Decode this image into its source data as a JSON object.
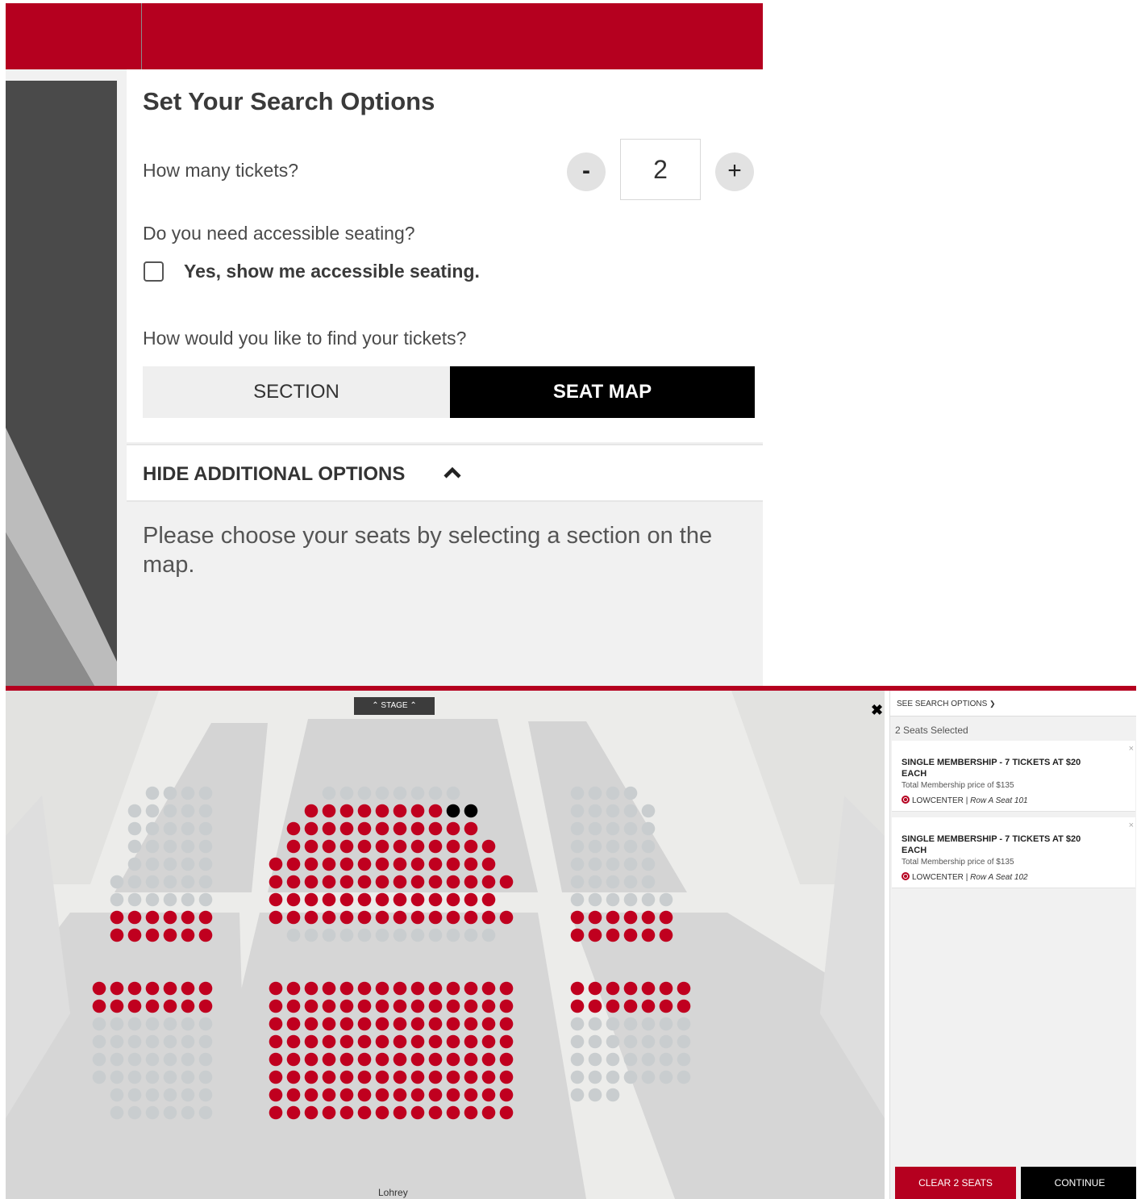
{
  "search_options": {
    "title": "Set Your Search Options",
    "tickets_question": "How many tickets?",
    "minus_label": "-",
    "plus_label": "+",
    "quantity": "2",
    "accessible_question": "Do you need accessible seating?",
    "accessible_checked": false,
    "accessible_label": "Yes, show me accessible seating.",
    "find_question": "How would you like to find your tickets?",
    "tabs": [
      {
        "label": "SECTION",
        "active": false
      },
      {
        "label": "SEAT MAP",
        "active": true
      }
    ],
    "hide_additional_label": "HIDE ADDITIONAL OPTIONS",
    "instructions": "Please choose your seats by selecting a section on the map."
  },
  "seat_map": {
    "stage_label": "STAGE",
    "venue_label": "Lohrey",
    "close_icon": "close-icon",
    "colors": {
      "available": "#c0001f",
      "unavailable": "#c9cdcf",
      "selected": "#000000",
      "brand": "#b5001f"
    },
    "sections": [
      {
        "name": "upper-left",
        "rows": [
          "..uuuu",
          ".uuuuu",
          ".uuuuu",
          ".uuuuu",
          ".uuuuu",
          "uuuuuu",
          "uuuuuu",
          "aaaaaa",
          "aaaaaa"
        ]
      },
      {
        "name": "upper-center",
        "rows": [
          "...uuuuuuuu",
          "..aaaaaaaass",
          ".aaaaaaaaaaa",
          ".aaaaaaaaaaaa",
          "aaaaaaaaaaaaa",
          "aaaaaaaaaaaaaa",
          "aaaaaaaaaaaaa",
          "aaaaaaaaaaaaaa",
          ".uuuuuuuuuuuu"
        ]
      },
      {
        "name": "upper-right",
        "rows": [
          "uuuu",
          "uuuuu",
          "uuuuu",
          "uuuuu",
          "uuuuu",
          "uuuuu",
          "uuuuuu",
          "aaaaaa",
          "aaaaaa"
        ]
      },
      {
        "name": "lower-left",
        "rows": [
          "aaaaaaa",
          "aaaaaaa",
          "uuuuuuu",
          "uuuuuuu",
          "uuuuuuu",
          "uuuuuuu",
          ".uuuuuu",
          ".uuuuuu"
        ]
      },
      {
        "name": "lower-center",
        "rows": [
          "aaaaaaaaaaaaaa",
          "aaaaaaaaaaaaaa",
          "aaaaaaaaaaaaaa",
          "aaaaaaaaaaaaaa",
          "aaaaaaaaaaaaaa",
          "aaaaaaaaaaaaaa",
          "aaaaaaaaaaaaaa",
          "aaaaaaaaaaaaaa"
        ]
      },
      {
        "name": "lower-right",
        "rows": [
          "aaaaaaa",
          "aaaaaaa",
          "uuuuuuu",
          "uuuuuuu",
          "uuuuuuu",
          "uuuuuuu",
          "uuu"
        ]
      }
    ]
  },
  "cart": {
    "see_search_label": "SEE SEARCH OPTIONS",
    "seats_selected": "2 Seats Selected",
    "items": [
      {
        "title": "SINGLE MEMBERSHIP - 7 TICKETS AT $20 EACH",
        "price": "Total Membership price of $135",
        "section": "LOWCENTER",
        "separator": "|",
        "seat": "Row A Seat 101",
        "remove": "×"
      },
      {
        "title": "SINGLE MEMBERSHIP - 7 TICKETS AT $20 EACH",
        "price": "Total Membership price of $135",
        "section": "LOWCENTER",
        "separator": "|",
        "seat": "Row A Seat 102",
        "remove": "×"
      }
    ],
    "clear_label": "CLEAR 2 SEATS",
    "continue_label": "CONTINUE"
  }
}
